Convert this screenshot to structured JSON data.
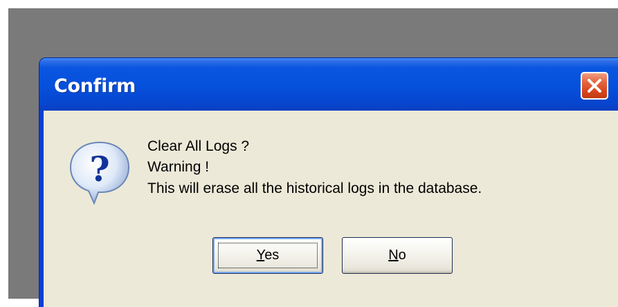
{
  "dialog": {
    "title": "Confirm",
    "close_icon": "close-x-icon",
    "icon": "question-bubble-icon",
    "messages": {
      "line1": "Clear All Logs ?",
      "line2": "Warning !",
      "line3": "This will erase all the historical logs in the database."
    },
    "buttons": {
      "yes": {
        "accel": "Y",
        "rest": "es",
        "default": true
      },
      "no": {
        "accel": "N",
        "rest": "o",
        "default": false
      }
    }
  },
  "colors": {
    "titlebar": "#0550dc",
    "client_bg": "#ece9d8",
    "close_button": "#d8471f"
  }
}
